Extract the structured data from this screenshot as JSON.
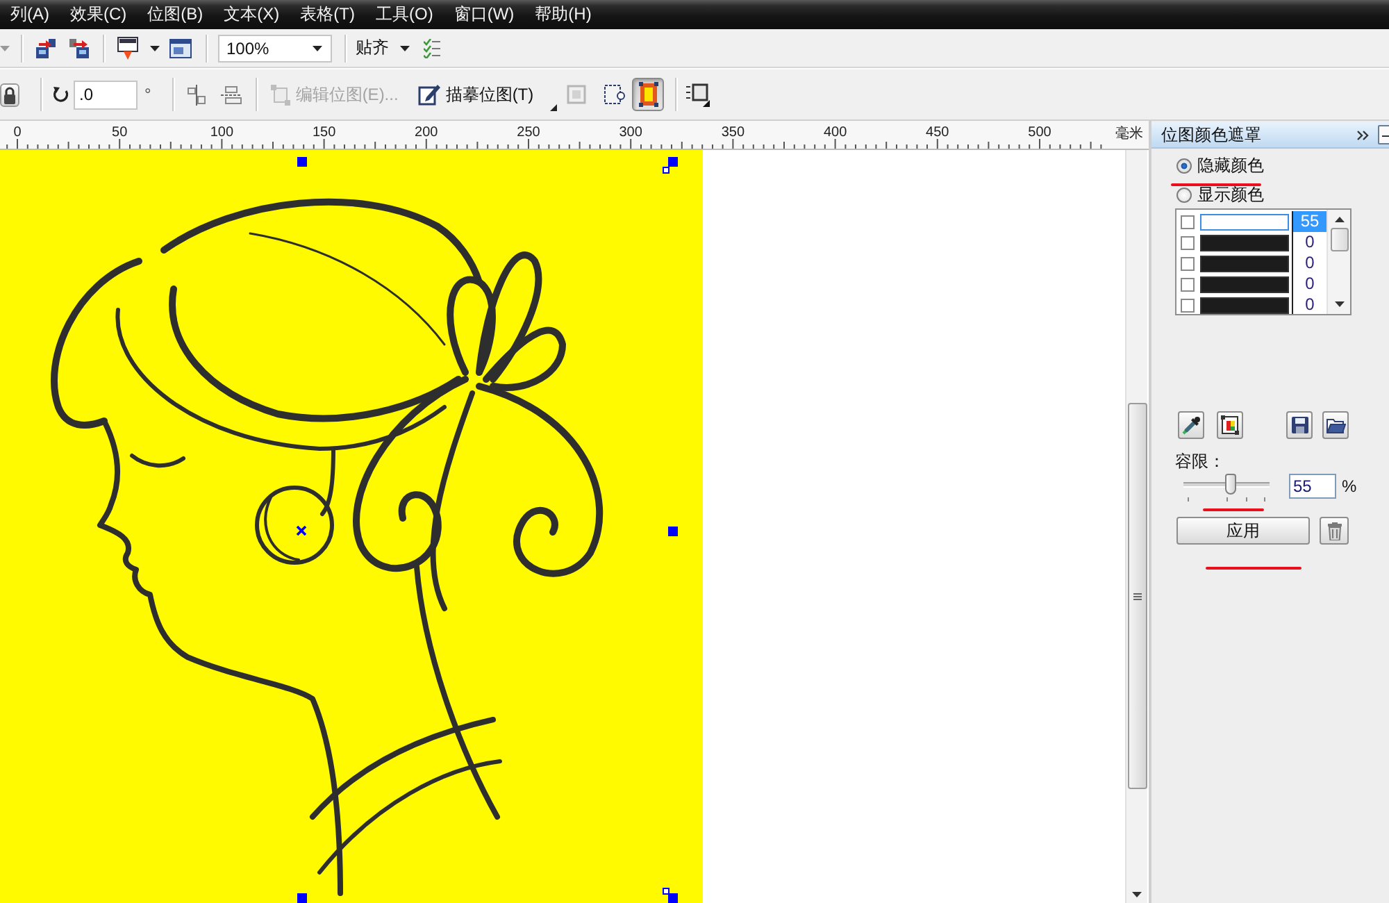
{
  "menu_bar": {
    "items": [
      "列(A)",
      "效果(C)",
      "位图(B)",
      "文本(X)",
      "表格(T)",
      "工具(O)",
      "窗口(W)",
      "帮助(H)"
    ]
  },
  "standard_toolbar": {
    "zoom": "100%",
    "snap": "贴齐"
  },
  "property_bar": {
    "rotation": ".0",
    "degree_sign": "°",
    "edit_bitmap": {
      "label": "编辑位图(E)...",
      "disabled": true
    },
    "trace_bitmap": {
      "label": "描摹位图(T)",
      "disabled": false
    },
    "color_mask_toggle": {
      "on": true
    }
  },
  "ruler": {
    "labels": [
      "0",
      "50",
      "100",
      "150",
      "200",
      "250",
      "300",
      "350",
      "400",
      "450",
      "500"
    ],
    "unit": "毫米"
  },
  "canvas": {
    "bitmap_selected": true
  },
  "docker": {
    "title": "位图颜色遮罩",
    "modes": [
      {
        "label": "隐藏颜色",
        "selected": true
      },
      {
        "label": "显示颜色",
        "selected": false
      }
    ],
    "colors": [
      {
        "checked": false,
        "color": "#ffffff",
        "value": "55",
        "selected": true
      },
      {
        "checked": false,
        "color": "#1c1c1c",
        "value": "0",
        "selected": false
      },
      {
        "checked": false,
        "color": "#1c1c1c",
        "value": "0",
        "selected": false
      },
      {
        "checked": false,
        "color": "#1c1c1c",
        "value": "0",
        "selected": false
      },
      {
        "checked": false,
        "color": "#1c1c1c",
        "value": "0",
        "selected": false
      }
    ],
    "tolerance_label": "容限：",
    "tolerance": {
      "level": 0.55,
      "value": "55",
      "unit": "%"
    },
    "apply": "应用"
  }
}
